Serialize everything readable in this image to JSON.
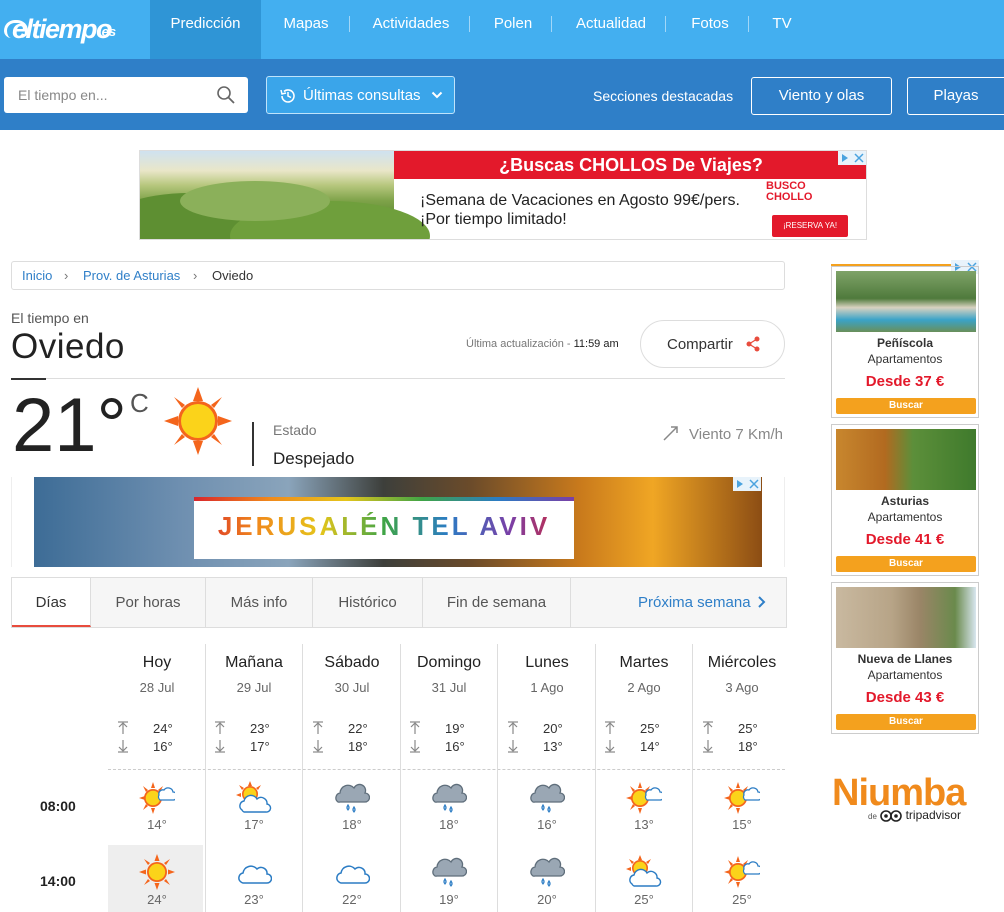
{
  "header": {
    "logo": "eltiempo",
    "logo_tld": ".es",
    "nav": [
      "Predicción",
      "Mapas",
      "Actividades",
      "Polen",
      "Actualidad",
      "Fotos",
      "TV"
    ],
    "active_nav": "Predicción"
  },
  "search": {
    "placeholder": "El tiempo en...",
    "recent_label": "Últimas consultas",
    "sections_label": "Secciones destacadas",
    "buttons": [
      "Viento y olas",
      "Playas"
    ]
  },
  "ad_top": {
    "headline": "¿Buscas CHOLLOS De Viajes?",
    "line1": "¡Semana de Vacaciones en Agosto 99€/pers.",
    "line2": "¡Por tiempo limitado!",
    "brand1": "BUSCO",
    "brand2": "CHOLLO",
    "cta": "¡RESERVA YA!"
  },
  "breadcrumb": [
    "Inicio",
    "Prov. de Asturias",
    "Oviedo"
  ],
  "location": {
    "prefix": "El tiempo en",
    "city": "Oviedo",
    "updated_label": "Última actualización - ",
    "updated_time": "11:59 am",
    "share_label": "Compartir"
  },
  "current": {
    "temp": "21°",
    "unit": "C",
    "estado_label": "Estado",
    "estado": "Despejado",
    "wind": "Viento 7 Km/h"
  },
  "ad_mid": {
    "text": "JERUSALÉN TEL AVIV"
  },
  "tabs": [
    "Días",
    "Por horas",
    "Más info",
    "Histórico",
    "Fin de semana"
  ],
  "active_tab": "Días",
  "next_week": "Próxima semana",
  "forecast": {
    "hours": [
      "08:00",
      "14:00"
    ],
    "days": [
      {
        "name": "Hoy",
        "date": "28 Jul",
        "max": "24°",
        "min": "16°",
        "h08": {
          "icon": "sun-cloud-icon",
          "temp": "14°"
        },
        "h14": {
          "icon": "sun-icon",
          "temp": "24°"
        }
      },
      {
        "name": "Mañana",
        "date": "29 Jul",
        "max": "23°",
        "min": "17°",
        "h08": {
          "icon": "partly-cloudy-icon",
          "temp": "17°"
        },
        "h14": {
          "icon": "cloud-icon",
          "temp": "23°"
        }
      },
      {
        "name": "Sábado",
        "date": "30 Jul",
        "max": "22°",
        "min": "18°",
        "h08": {
          "icon": "rain-cloud-icon",
          "temp": "18°"
        },
        "h14": {
          "icon": "cloud-icon",
          "temp": "22°"
        }
      },
      {
        "name": "Domingo",
        "date": "31 Jul",
        "max": "19°",
        "min": "16°",
        "h08": {
          "icon": "rain-cloud-icon",
          "temp": "18°"
        },
        "h14": {
          "icon": "rain-cloud-icon",
          "temp": "19°"
        }
      },
      {
        "name": "Lunes",
        "date": "1 Ago",
        "max": "20°",
        "min": "13°",
        "h08": {
          "icon": "rain-cloud-icon",
          "temp": "16°"
        },
        "h14": {
          "icon": "rain-cloud-icon",
          "temp": "20°"
        }
      },
      {
        "name": "Martes",
        "date": "2 Ago",
        "max": "25°",
        "min": "14°",
        "h08": {
          "icon": "sun-cloud-icon",
          "temp": "13°"
        },
        "h14": {
          "icon": "partly-cloudy-icon",
          "temp": "25°"
        }
      },
      {
        "name": "Miércoles",
        "date": "3 Ago",
        "max": "25°",
        "min": "18°",
        "h08": {
          "icon": "sun-cloud-icon",
          "temp": "15°"
        },
        "h14": {
          "icon": "sun-cloud-icon",
          "temp": "25°"
        }
      }
    ]
  },
  "side_ads": [
    {
      "place": "Peñíscola",
      "type": "Apartamentos",
      "price": "Desde 37 €",
      "cta": "Buscar"
    },
    {
      "place": "Asturias",
      "type": "Apartamentos",
      "price": "Desde 41 €",
      "cta": "Buscar"
    },
    {
      "place": "Nueva de Llanes",
      "type": "Apartamentos",
      "price": "Desde 43 €",
      "cta": "Buscar"
    }
  ],
  "niumba": {
    "name": "Niumba",
    "sub_prefix": "de",
    "sub_brand": "tripadvisor"
  },
  "colors": {
    "nav_bg": "#43aff0",
    "search_bg": "#2f7fc8",
    "accent_red": "#e84c3d",
    "link": "#2f7fc8"
  }
}
